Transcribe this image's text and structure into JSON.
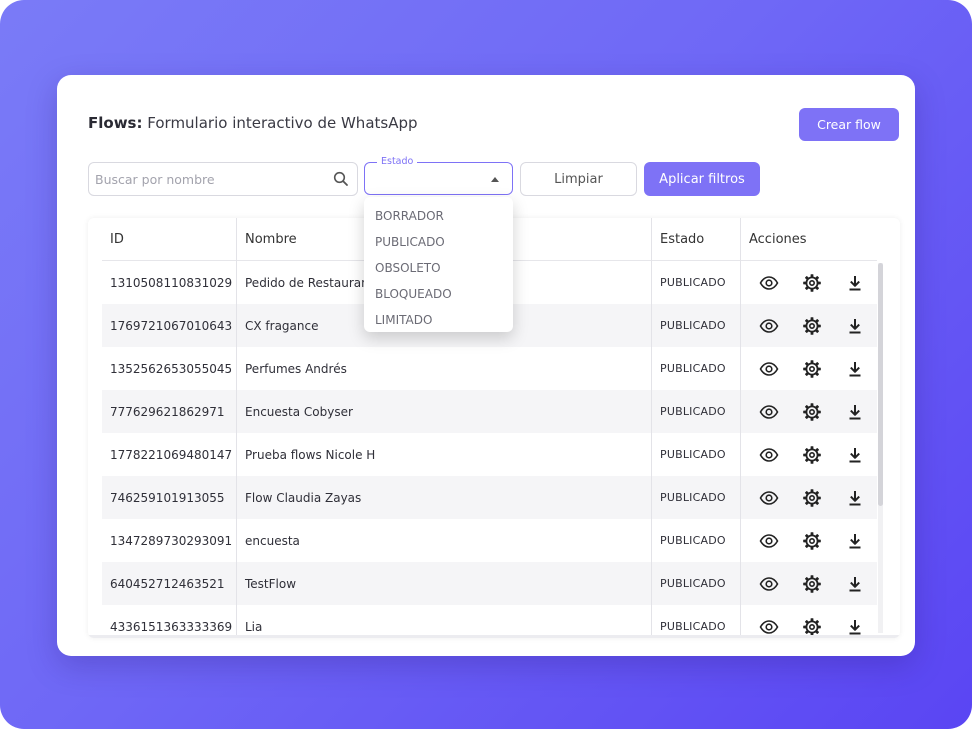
{
  "header": {
    "title_bold": "Flows:",
    "title_rest": "Formulario interactivo de WhatsApp",
    "create_label": "Crear flow"
  },
  "filters": {
    "search_placeholder": "Buscar por nombre",
    "estado_legend": "Estado",
    "estado_value": "",
    "clear_label": "Limpiar",
    "apply_label": "Aplicar filtros"
  },
  "dropdown": {
    "options": [
      "BORRADOR",
      "PUBLICADO",
      "OBSOLETO",
      "BLOQUEADO",
      "LIMITADO"
    ]
  },
  "table": {
    "headers": [
      "ID",
      "Nombre",
      "Estado",
      "Acciones"
    ],
    "rows": [
      {
        "id": "1310508110831029",
        "nombre": "Pedido de Restaurante",
        "estado": "PUBLICADO"
      },
      {
        "id": "1769721067010643",
        "nombre": "CX fragance",
        "estado": "PUBLICADO"
      },
      {
        "id": "1352562653055045",
        "nombre": "Perfumes Andrés",
        "estado": "PUBLICADO"
      },
      {
        "id": "777629621862971",
        "nombre": "Encuesta Cobyser",
        "estado": "PUBLICADO"
      },
      {
        "id": "1778221069480147",
        "nombre": "Prueba flows Nicole H",
        "estado": "PUBLICADO"
      },
      {
        "id": "746259101913055",
        "nombre": "Flow Claudia Zayas",
        "estado": "PUBLICADO"
      },
      {
        "id": "1347289730293091",
        "nombre": "encuesta",
        "estado": "PUBLICADO"
      },
      {
        "id": "640452712463521",
        "nombre": "TestFlow",
        "estado": "PUBLICADO"
      },
      {
        "id": "4336151363333369",
        "nombre": "Lia",
        "estado": "PUBLICADO"
      }
    ]
  },
  "icons": {
    "search": "search-icon",
    "view": "eye-icon",
    "settings": "gear-icon",
    "download": "download-icon"
  },
  "colors": {
    "accent": "#7e72f6",
    "background_gradient_start": "#7a7bf7",
    "background_gradient_end": "#5a45f3"
  }
}
